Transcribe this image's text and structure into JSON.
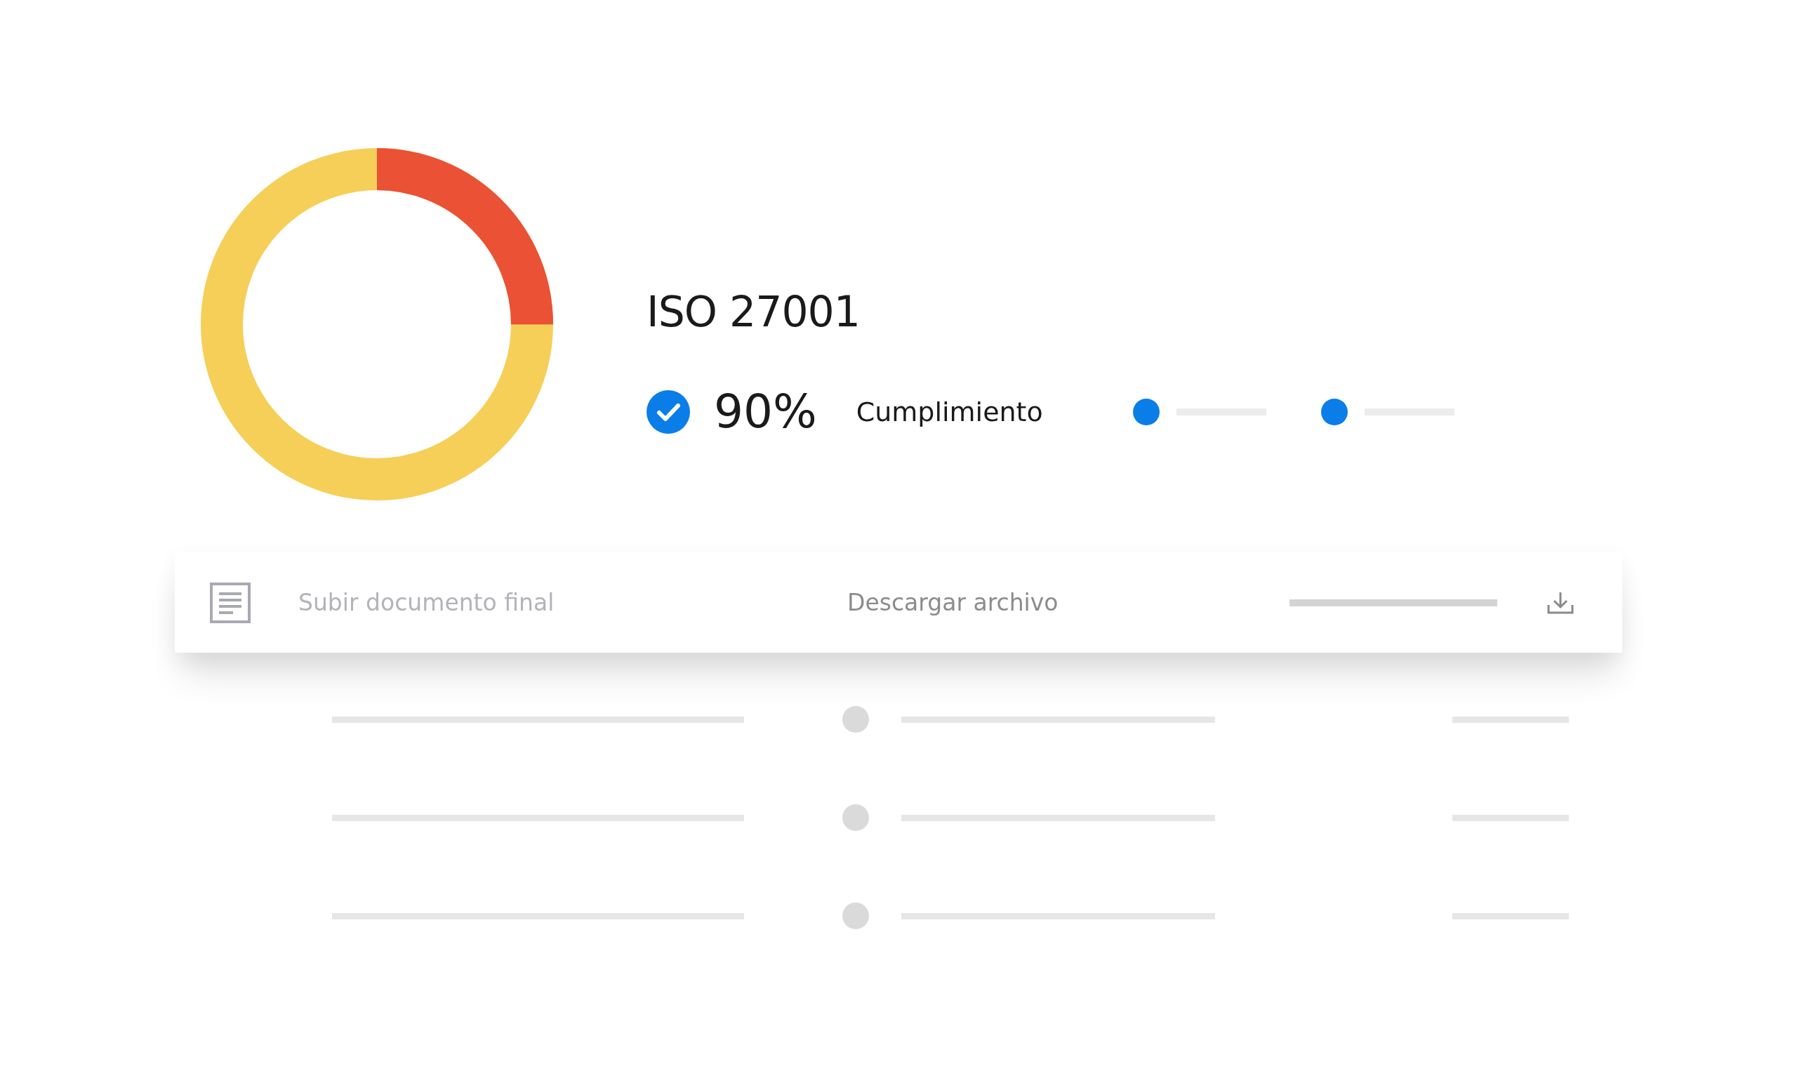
{
  "standard": {
    "title": "ISO 27001",
    "verified": true,
    "percent": "90%",
    "label": "Cumplimiento"
  },
  "document_row": {
    "upload_label": "Subir documento final",
    "download_label": "Descargar archivo"
  }
}
